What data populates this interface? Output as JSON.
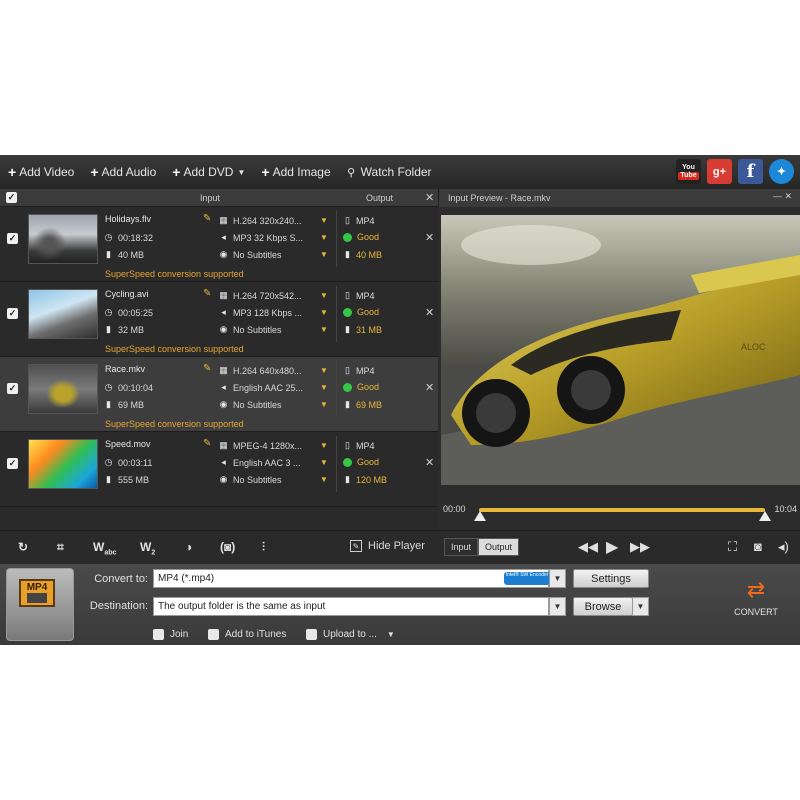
{
  "toolbar": {
    "add_video": "Add Video",
    "add_audio": "Add Audio",
    "add_dvd": "Add DVD",
    "add_image": "Add Image",
    "watch_folder": "Watch Folder"
  },
  "social": {
    "youtube": "You Tube",
    "gplus": "g+",
    "facebook": "f"
  },
  "list": {
    "header_input": "Input",
    "header_output": "Output",
    "files": [
      {
        "name": "Holidays.flv",
        "duration": "00:18:32",
        "size": "40 MB",
        "video": "H.264 320x240...",
        "audio": "MP3 32 Kbps S...",
        "subs": "No Subtitles",
        "out_format": "MP4",
        "out_quality": "Good",
        "out_size": "40 MB",
        "note": "SuperSpeed conversion supported"
      },
      {
        "name": "Cycling.avi",
        "duration": "00:05:25",
        "size": "32 MB",
        "video": "H.264 720x542...",
        "audio": "MP3 128 Kbps ...",
        "subs": "No Subtitles",
        "out_format": "MP4",
        "out_quality": "Good",
        "out_size": "31 MB",
        "note": "SuperSpeed conversion supported"
      },
      {
        "name": "Race.mkv",
        "duration": "00:10:04",
        "size": "69 MB",
        "video": "H.264 640x480...",
        "audio": "English AAC 25...",
        "subs": "No Subtitles",
        "out_format": "MP4",
        "out_quality": "Good",
        "out_size": "69 MB",
        "note": "SuperSpeed conversion supported"
      },
      {
        "name": "Speed.mov",
        "duration": "00:03:11",
        "size": "555 MB",
        "video": "MPEG-4 1280x...",
        "audio": "English AAC 3 ...",
        "subs": "No Subtitles",
        "out_format": "MP4",
        "out_quality": "Good",
        "out_size": "120 MB",
        "note": ""
      }
    ]
  },
  "preview": {
    "title": "Input Preview - Race.mkv",
    "time_start": "00:00",
    "time_end": "10:04",
    "car_text": "ALOC"
  },
  "editbar": {
    "hide_player": "Hide Player",
    "toggle_input": "Input",
    "toggle_output": "Output",
    "watermark": "W",
    "watermark_sub": "abc",
    "watermark2_sub": "2"
  },
  "bottom": {
    "format_icon": "MP4",
    "convert_to_label": "Convert to:",
    "convert_to_value": "MP4 (*.mp4)",
    "intel_badge": "Intel® SW Encoder",
    "settings_button": "Settings",
    "destination_label": "Destination:",
    "destination_value": "The output folder is the same as input",
    "browse_button": "Browse",
    "join": "Join",
    "add_itunes": "Add to iTunes",
    "upload": "Upload to ...",
    "convert": "CONVERT"
  },
  "colors": {
    "accent": "#e8b73a",
    "good": "#35c645",
    "note": "#e8a532"
  }
}
